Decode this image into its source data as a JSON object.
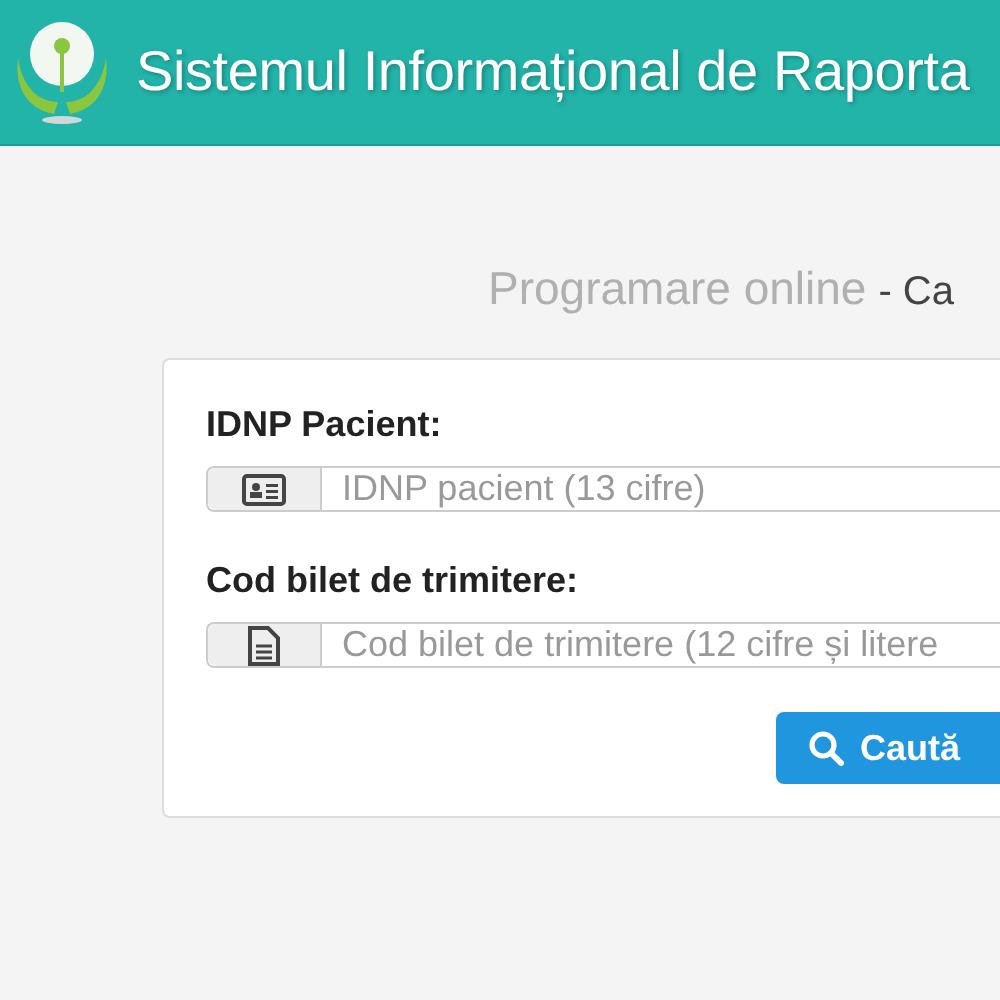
{
  "header": {
    "title": "Sistemul Informațional de Raporta"
  },
  "subtitle": {
    "main": "Programare online",
    "suffix": "- Ca"
  },
  "form": {
    "fields": [
      {
        "kind": "id",
        "label": "IDNP Pacient:",
        "placeholder": "IDNP pacient (13 cifre)"
      },
      {
        "kind": "document",
        "label": "Cod bilet de trimitere:",
        "placeholder": "Cod bilet de trimitere (12 cifre și litere"
      }
    ],
    "button": "Caută"
  }
}
